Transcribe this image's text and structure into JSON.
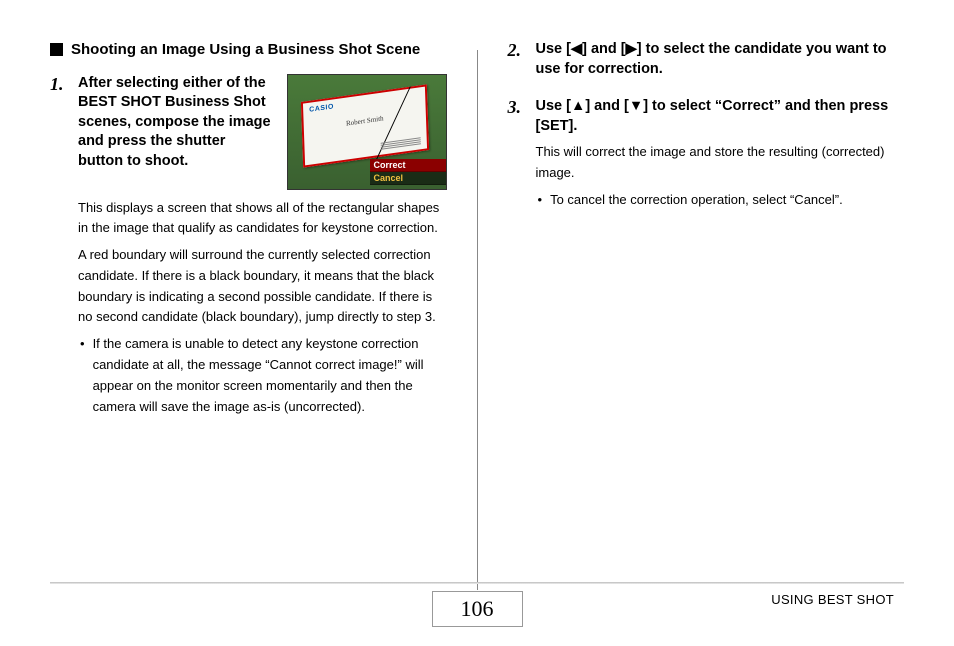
{
  "heading": "Shooting an Image Using a Business Shot Scene",
  "step1": {
    "num": "1.",
    "title": "After selecting either of the BEST SHOT Business Shot scenes, compose the image and press the shutter button to shoot.",
    "para1": "This displays a screen that shows all of the rectangular shapes in the image that qualify as candidates for keystone correction.",
    "para2": "A red boundary will surround the currently selected correction candidate. If there is a black boundary, it means that the black boundary is indicating a second possible candidate. If there is no second candidate (black boundary), jump directly to step 3.",
    "bullet": "If the camera is unable to detect any keystone correction candidate at all, the message “Cannot correct image!” will appear on the monitor screen momentarily and then the camera will save the image as-is (uncorrected)."
  },
  "screenshot": {
    "brand": "CASIO",
    "name": "Robert Smith",
    "menu_correct": "Correct",
    "menu_cancel": "Cancel"
  },
  "step2": {
    "num": "2.",
    "title_pre": "Use [",
    "title_mid": "] and [",
    "title_post": "] to select the candidate you want to use for correction."
  },
  "step3": {
    "num": "3.",
    "title_pre": "Use [",
    "title_mid": "] and [",
    "title_post": "] to select “Correct” and then press [SET].",
    "para": "This will correct the image and store the resulting (corrected) image.",
    "bullet": "To cancel the correction operation, select “Cancel”."
  },
  "footer": {
    "page": "106",
    "label": "USING BEST SHOT"
  }
}
